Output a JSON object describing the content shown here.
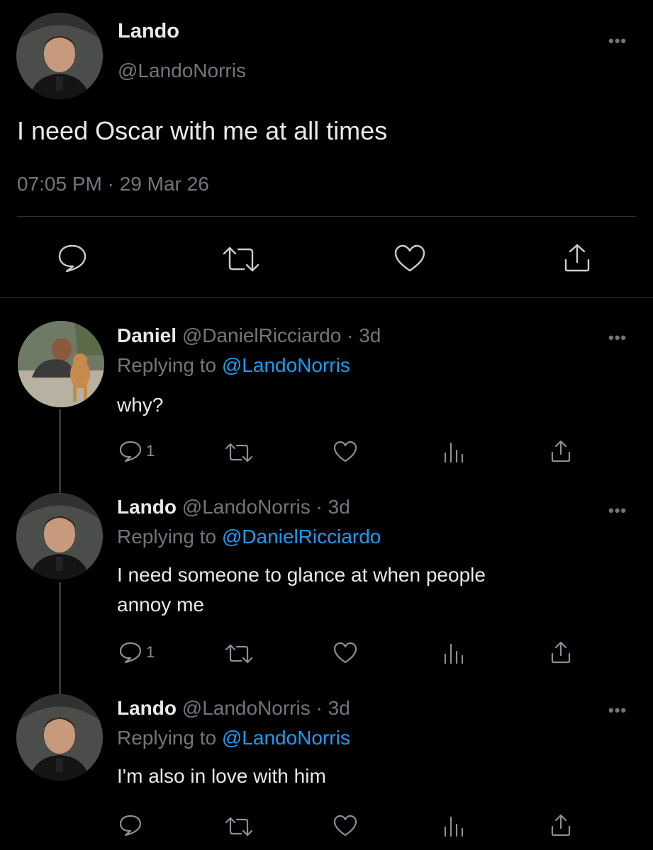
{
  "main_tweet": {
    "display_name": "Lando",
    "handle": "@LandoNorris",
    "text": "I need Oscar with me at all times",
    "timestamp": "07:05 PM · 29 Mar 26",
    "more": "•••"
  },
  "replies": [
    {
      "display_name": "Daniel",
      "handle": "@DanielRicciardo",
      "age": "· 3d",
      "replying_label": "Replying to",
      "replying_to": "@LandoNorris",
      "text_lines": [
        "why?"
      ],
      "reply_count": "1",
      "more": "•••"
    },
    {
      "display_name": "Lando",
      "handle": "@LandoNorris",
      "age": "· 3d",
      "replying_label": "Replying to",
      "replying_to": "@DanielRicciardo",
      "text_lines": [
        "I need someone to glance at when people",
        "annoy me"
      ],
      "reply_count": "1",
      "more": "•••"
    },
    {
      "display_name": "Lando",
      "handle": "@LandoNorris",
      "age": "· 3d",
      "replying_label": "Replying to",
      "replying_to": "@LandoNorris",
      "text_lines": [
        "I'm also in love with him"
      ],
      "reply_count": "",
      "more": "•••"
    }
  ],
  "colors": {
    "background": "#000000",
    "text": "#e7e9ea",
    "muted": "#71767b",
    "link": "#1d9bf0"
  }
}
